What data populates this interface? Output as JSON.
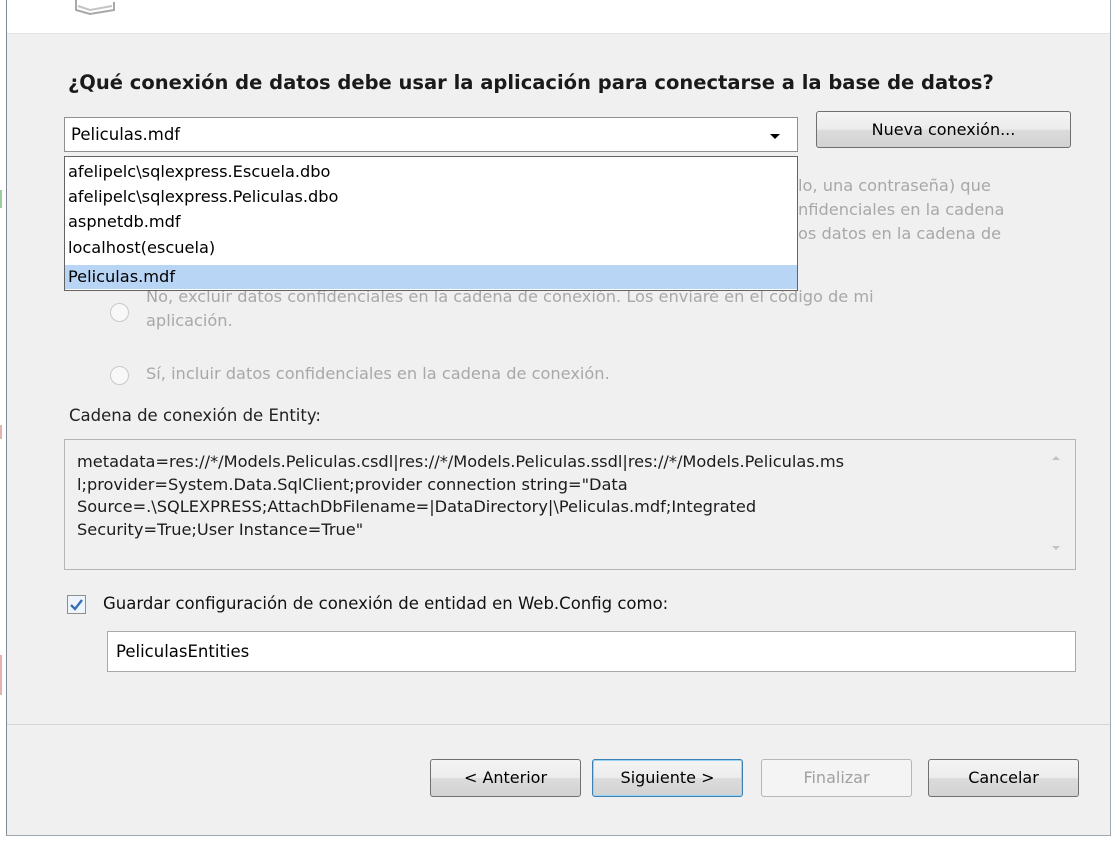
{
  "wizard": {
    "question": "¿Qué conexión de datos debe usar la aplicación para conectarse a la base de datos?",
    "connection_combo": {
      "selected": "Peliculas.mdf"
    },
    "new_connection_button": "Nueva conexión...",
    "dropdown_options": [
      "afelipelc\\sqlexpress.Escuela.dbo",
      "afelipelc\\sqlexpress.Peliculas.dbo",
      "aspnetdb.mdf",
      "localhost(escuela)",
      "Peliculas.mdf"
    ],
    "dropdown_selected_index": 4,
    "hidden_text": {
      "line1": "lo, una contraseña) que",
      "line2": "nfidenciales en la cadena",
      "line3": "os datos en la cadena de"
    },
    "radio_exclude": {
      "line1": "No, excluir datos confidenciales en la cadena de conexión. Los enviaré en el código de mi",
      "line2": "aplicación."
    },
    "radio_include": "Sí, incluir datos confidenciales en la cadena de conexión.",
    "entity_label": "Cadena de conexión de Entity:",
    "entity_connection_string": "metadata=res://*/Models.Peliculas.csdl|res://*/Models.Peliculas.ssdl|res://*/Models.Peliculas.msl;provider=System.Data.SqlClient;provider connection string=\"Data Source=.\\SQLEXPRESS;AttachDbFilename=|DataDirectory|\\Peliculas.mdf;Integrated Security=True;User Instance=True\"",
    "entity_lines": [
      "metadata=res://*/Models.Peliculas.csdl|res://*/Models.Peliculas.ssdl|res://*/Models.Peliculas.ms",
      "l;provider=System.Data.SqlClient;provider connection string=\"Data",
      "Source=.\\SQLEXPRESS;AttachDbFilename=|DataDirectory|\\Peliculas.mdf;Integrated",
      "Security=True;User Instance=True\""
    ],
    "save_checkbox": {
      "checked": true,
      "label": "Guardar configuración de conexión de entidad en Web.Config como:"
    },
    "entities_name": "PeliculasEntities"
  },
  "footer": {
    "previous": "< Anterior",
    "next": "Siguiente >",
    "finish": "Finalizar",
    "cancel": "Cancelar"
  },
  "colors": {
    "dialog_bg": "#f0f0f0",
    "selection": "#b8d5f5",
    "disabled_text": "#a8a8a8",
    "check_mark": "#3a6fb5"
  }
}
